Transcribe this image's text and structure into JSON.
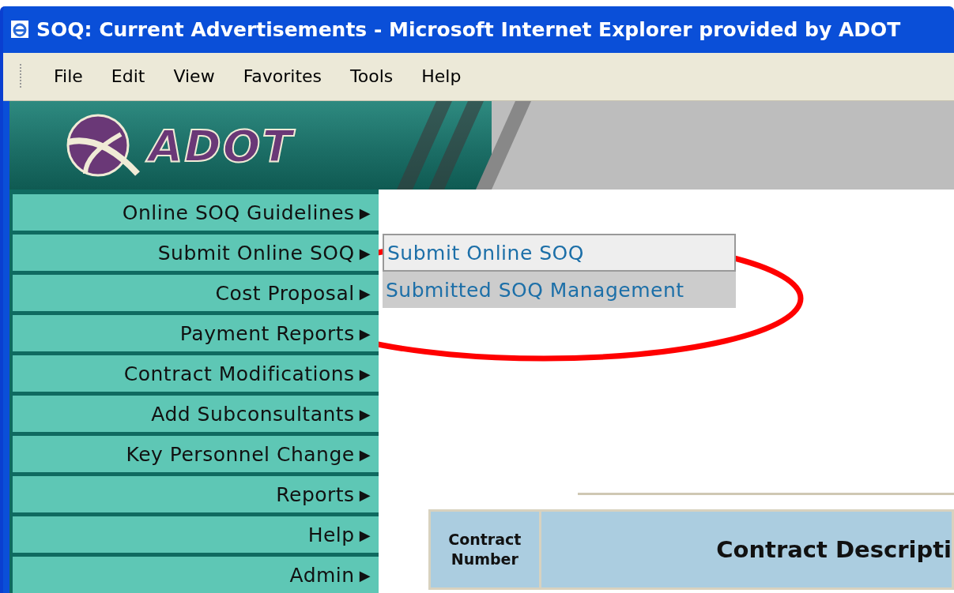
{
  "window": {
    "title": "SOQ: Current Advertisements - Microsoft Internet Explorer provided by ADOT"
  },
  "menu_bar": [
    "File",
    "Edit",
    "View",
    "Favorites",
    "Tools",
    "Help"
  ],
  "banner": {
    "logo_text": "ADOT"
  },
  "sidebar": {
    "items": [
      {
        "label": "Online SOQ Guidelines",
        "arrow": "▶"
      },
      {
        "label": "Submit Online SOQ",
        "arrow": "▶"
      },
      {
        "label": "Cost Proposal",
        "arrow": "▶"
      },
      {
        "label": "Payment Reports",
        "arrow": "▶"
      },
      {
        "label": "Contract Modifications",
        "arrow": "▶"
      },
      {
        "label": "Add Subconsultants",
        "arrow": "▶"
      },
      {
        "label": "Key Personnel Change",
        "arrow": "▶"
      },
      {
        "label": "Reports",
        "arrow": "▶"
      },
      {
        "label": "Help",
        "arrow": "▶"
      },
      {
        "label": "Admin",
        "arrow": "▶"
      }
    ]
  },
  "submenu": {
    "items": [
      {
        "label": "Submit Online SOQ",
        "selected": true
      },
      {
        "label": "Submitted SOQ Management",
        "selected": false
      }
    ]
  },
  "table": {
    "columns": [
      "Contract\nNumber",
      "Contract Descripti"
    ]
  }
}
